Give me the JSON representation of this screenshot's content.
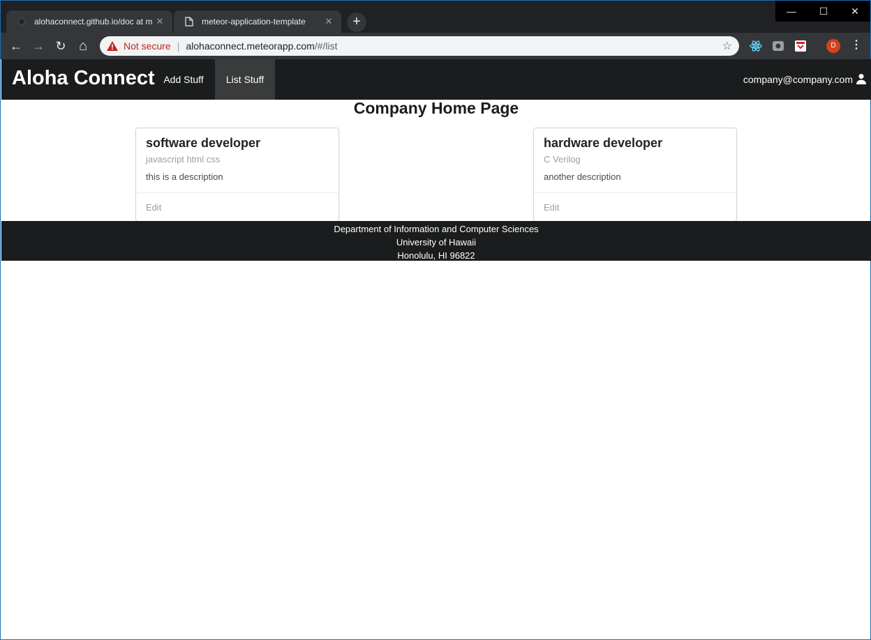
{
  "browser": {
    "tabs": [
      {
        "title": "alohaconnect.github.io/doc at m",
        "close": "✕"
      },
      {
        "title": "meteor-application-template",
        "close": "✕"
      }
    ],
    "new_tab": "+",
    "window": {
      "minimize": "—",
      "maximize": "☐",
      "close": "✕"
    },
    "nav": {
      "back": "←",
      "forward": "→",
      "reload": "↻",
      "home": "⌂"
    },
    "security_label": "Not secure",
    "url_host": "alohaconnect.meteorapp.com",
    "url_path": "/#/list",
    "bookmark": "☆",
    "profile_initial": "D",
    "menu": "⋮"
  },
  "navbar": {
    "brand": "Aloha Connect",
    "items": [
      "Add Stuff",
      "List Stuff"
    ],
    "active_item": "List Stuff",
    "user": "company@company.com"
  },
  "main": {
    "title": "Company Home Page",
    "cards": [
      {
        "header": "software developer",
        "meta": "javascript html css",
        "description": "this is a description",
        "action": "Edit"
      },
      {
        "header": "hardware developer",
        "meta": "C Verilog",
        "description": "another description",
        "action": "Edit"
      }
    ]
  },
  "footer": {
    "lines": [
      "Department of Information and Computer Sciences",
      "University of Hawaii",
      "Honolulu, HI 96822"
    ]
  },
  "colors": {
    "navbar_bg": "#1b1c1d",
    "active_nav_bg": "#3a3b3c",
    "warning_red": "#c5221f"
  }
}
